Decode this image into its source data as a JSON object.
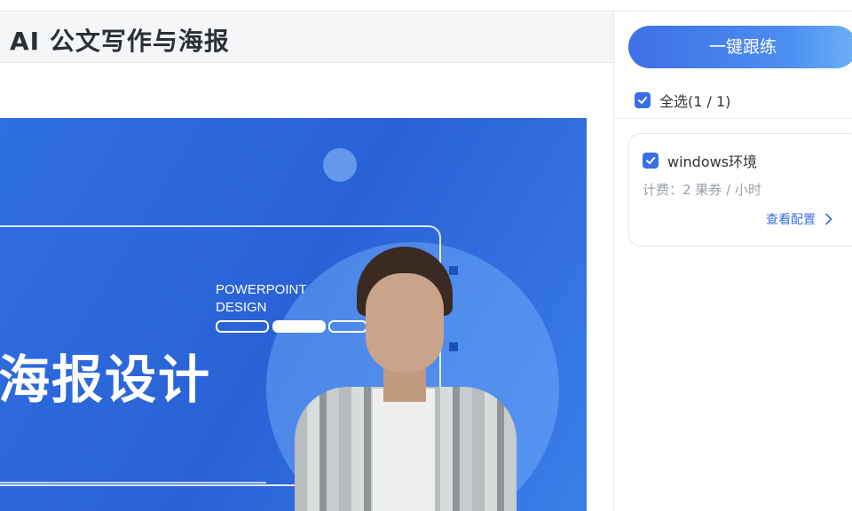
{
  "header": {
    "title": "AI 公文写作与海报"
  },
  "banner": {
    "pp_label": "POWERPOINT\nDESIGN",
    "headline": "海报设计"
  },
  "sidebar": {
    "practice_button": "一键跟练",
    "select_all_label": "全选(1 / 1)",
    "environments": [
      {
        "name": "windows环境",
        "price": "计费：2 果券 / 小时",
        "config_link": "查看配置"
      }
    ]
  },
  "icons": {
    "checkbox": "checkbox-checked-icon",
    "chevron": "chevron-right-icon"
  },
  "colors": {
    "accent": "#3b6fe8",
    "banner": "#2a62d6"
  }
}
